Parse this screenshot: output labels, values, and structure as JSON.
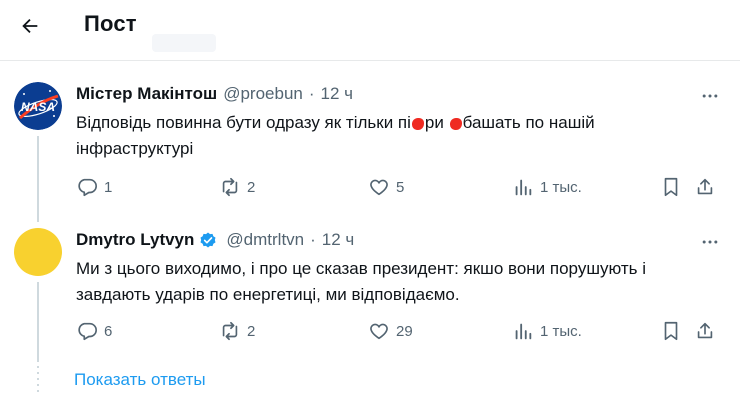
{
  "header": {
    "title": "Пост"
  },
  "tweets": [
    {
      "author": "Містер Макінтош",
      "handle": "@proebun",
      "time": "12 ч",
      "text_parts": [
        "Відповідь повинна бути одразу як тільки пі",
        "ри ",
        "башать по нашій інфраструктурі"
      ],
      "avatar_text": "NASA",
      "replies": "1",
      "retweets": "2",
      "likes": "5",
      "views": "1 тыс."
    },
    {
      "author": "Dmytro Lytvyn",
      "handle": "@dmtrltvn",
      "time": "12 ч",
      "text": "Ми з цього виходимо, і про це сказав президент: якшо вони порушують і завдають ударів по енергетиці, ми відповідаємо.",
      "replies": "6",
      "retweets": "2",
      "likes": "29",
      "views": "1 тыс."
    }
  ],
  "show_replies": "Показать ответы",
  "colors": {
    "accent": "#1d9bf0",
    "muted": "#536471",
    "avatar2": "#f8d12f",
    "redaction": "#ef2b22"
  }
}
